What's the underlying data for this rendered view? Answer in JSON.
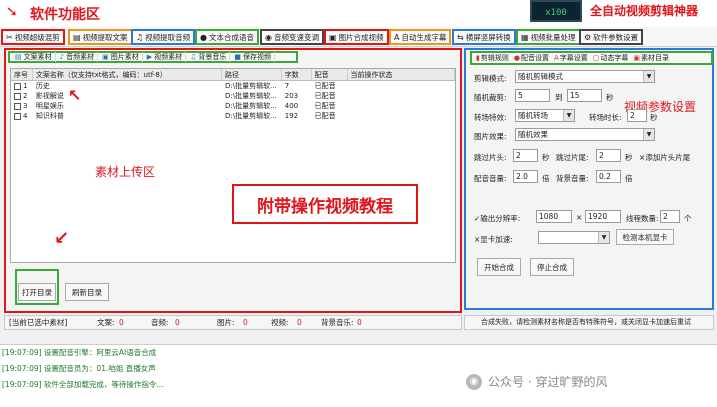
{
  "header": {
    "area_label": "软件功能区",
    "brand_label": "全自动视频剪辑神器",
    "logo_text": "x100"
  },
  "toolbar": [
    {
      "label": "视频超级混剪",
      "icon": "scissors-icon",
      "border": "#e0161b"
    },
    {
      "label": "视频提取文案",
      "icon": "document-icon",
      "border": "#e69a1a"
    },
    {
      "label": "视频提取音频",
      "icon": "audio-icon",
      "border": "#2a7bd6"
    },
    {
      "label": "文本合成语音",
      "icon": "microphone-icon",
      "border": "#3aaa35"
    },
    {
      "label": "音频变速变调",
      "icon": "tone-icon",
      "border": "#444444"
    },
    {
      "label": "图片合成视频",
      "icon": "image-icon",
      "border": "#e0161b"
    },
    {
      "label": "自动生成字幕",
      "icon": "subtitle-icon",
      "border": "#e69a1a"
    },
    {
      "label": "横屏竖屏转换",
      "icon": "rotate-icon",
      "border": "#2a7bd6"
    },
    {
      "label": "视频批量处理",
      "icon": "batch-icon",
      "border": "#3aaa35"
    },
    {
      "label": "软件参数设置",
      "icon": "gear-icon",
      "border": "#444444"
    }
  ],
  "material_tabs": [
    "文案素材",
    "音频素材",
    "图片素材",
    "视频素材",
    "背景音乐",
    "保存视频"
  ],
  "table": {
    "headers": [
      "序号",
      "文案名称（仅支持txt格式，编码：utf-8）",
      "路径",
      "字数",
      "配音",
      "当前操作状态"
    ],
    "rows": [
      {
        "no": "1",
        "name": "历史",
        "path": "D:\\批量剪辑软...",
        "count": "7",
        "dub": "已配音",
        "status": ""
      },
      {
        "no": "2",
        "name": "影视解说",
        "path": "D:\\批量剪辑软...",
        "count": "203",
        "dub": "已配音",
        "status": ""
      },
      {
        "no": "3",
        "name": "明星娱乐",
        "path": "D:\\批量剪辑软...",
        "count": "400",
        "dub": "已配音",
        "status": ""
      },
      {
        "no": "4",
        "name": "知识科普",
        "path": "D:\\批量剪辑软...",
        "count": "192",
        "dub": "已配音",
        "status": ""
      }
    ]
  },
  "left_panel": {
    "upload_label": "素材上传区",
    "tutorial_label": "附带操作视频教程",
    "open_dir": "打开目录",
    "refresh_dir": "刷新目录"
  },
  "right_tabs": [
    "剪辑规则",
    "配音设置",
    "字幕设置",
    "动态字幕",
    "素材目录"
  ],
  "settings": {
    "cut_mode_label": "剪辑模式:",
    "cut_mode_value": "随机剪辑模式",
    "random_cut_label": "随机裁剪:",
    "random_cut_from": "5",
    "random_cut_to_label": "到",
    "random_cut_to": "15",
    "sec": "秒",
    "transition_label": "转场特效:",
    "transition_value": "随机转场",
    "transition_dur_label": "转场时长:",
    "transition_dur": "2",
    "image_effect_label": "图片效果:",
    "image_effect_value": "随机效果",
    "skip_head_label": "跳过片头:",
    "skip_head": "2",
    "skip_tail_label": "跳过片尾:",
    "skip_tail": "2",
    "add_head_tail_label": "添加片头片尾",
    "dub_volume_label": "配音音量:",
    "dub_volume": "2.0",
    "times": "倍",
    "bgm_volume_label": "背景音量:",
    "bgm_volume": "0.2",
    "output_res_label": "输出分辨率:",
    "res_w": "1080",
    "res_x": "×",
    "res_h": "1920",
    "threads_label": "线程数量:",
    "threads": "2",
    "threads_unit": "个",
    "gpu_label": "显卡加速:",
    "gpu_value": "",
    "detect_gpu": "检测本机显卡",
    "start": "开始合成",
    "stop": "停止合成",
    "param_label": "视频参数设置"
  },
  "status": {
    "selected_label": "[当前已选中素材]",
    "doc_label": "文案:",
    "doc": "0",
    "audio_label": "音频:",
    "audio": "0",
    "image_label": "图片:",
    "image": "0",
    "video_label": "视频:",
    "video": "0",
    "bgm_label": "背景音乐:",
    "bgm": "0",
    "right_msg": "合成失败，请检测素材名称是否有特殊符号，或关闭显卡加速后重试"
  },
  "log": [
    "[19:07:09] 设置配音引擎：阿里云AI语音合成",
    "[19:07:09] 设置配音员为：01.咱姐 直播女声",
    "[19:07:09] 软件全部加载完成，等待操作指令..."
  ],
  "watermark": "公众号 · 穿过旷野的风"
}
